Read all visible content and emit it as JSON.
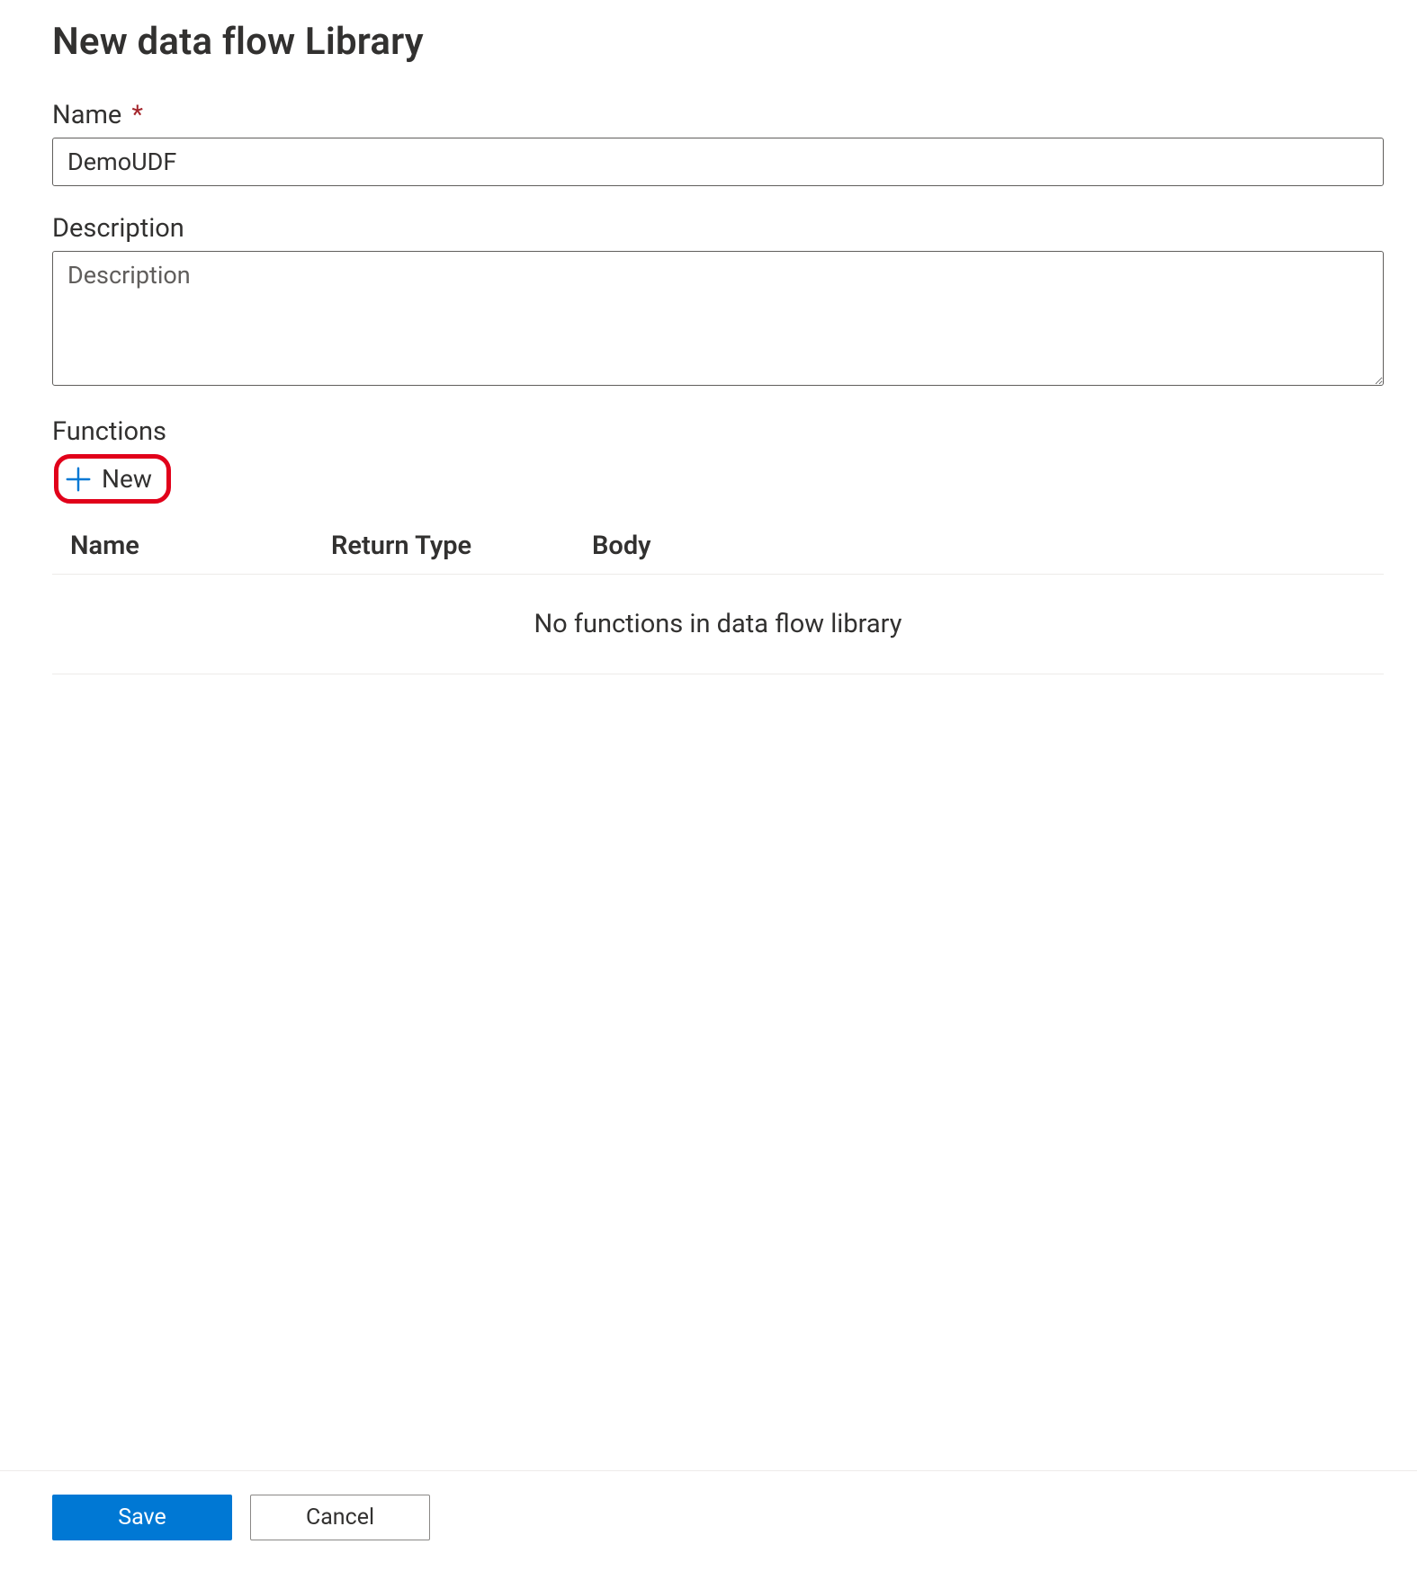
{
  "title": "New data flow Library",
  "name": {
    "label": "Name",
    "required_marker": "*",
    "value": "DemoUDF"
  },
  "description": {
    "label": "Description",
    "placeholder": "Description",
    "value": ""
  },
  "functions": {
    "label": "Functions",
    "new_button_label": "New",
    "columns": {
      "name": "Name",
      "return_type": "Return Type",
      "body": "Body"
    },
    "empty_message": "No functions in data flow library",
    "rows": []
  },
  "footer": {
    "save": "Save",
    "cancel": "Cancel"
  },
  "colors": {
    "primary": "#0078d4",
    "highlight_border": "#e1001a",
    "text": "#323130"
  }
}
